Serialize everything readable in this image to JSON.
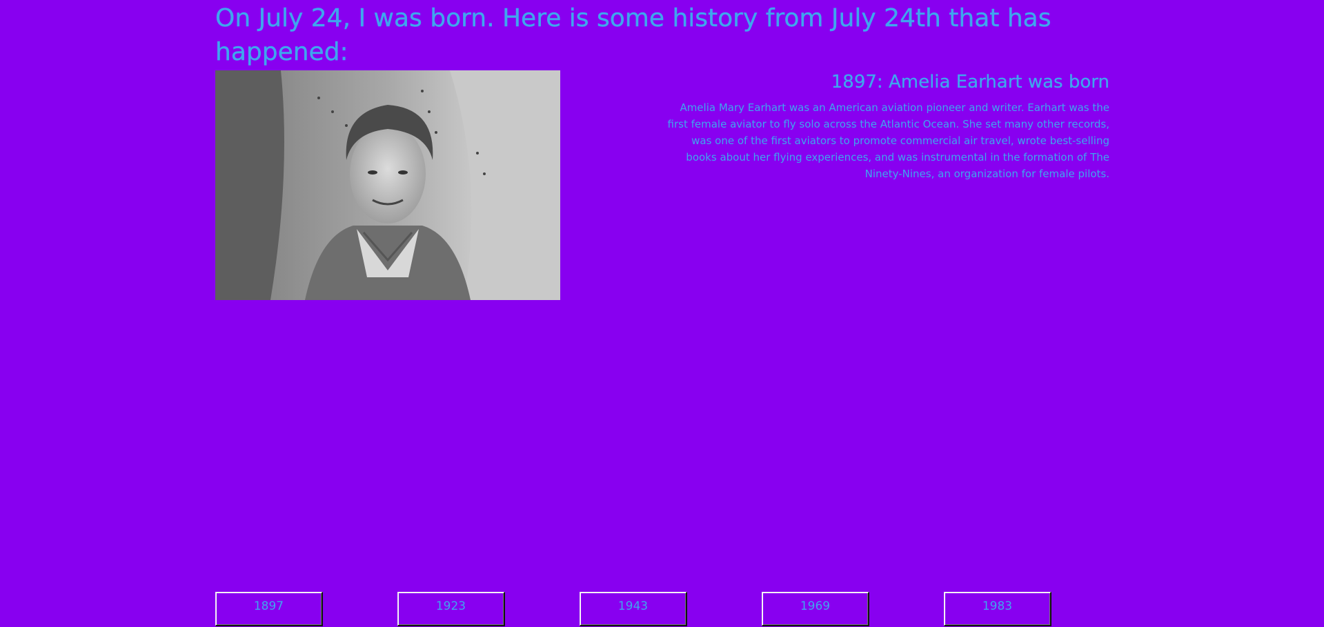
{
  "page": {
    "heading": "On July 24, I was born. Here is some history from July 24th that has happened:"
  },
  "event": {
    "title": "1897: Amelia Earhart was born",
    "description": "Amelia Mary Earhart was an American aviation pioneer and writer. Earhart was the first female aviator to fly solo across the Atlantic Ocean. She set many other records, was one of the first aviators to promote commercial air travel, wrote best-selling books about her flying experiences, and was instrumental in the formation of The Ninety-Nines, an organization for female pilots."
  },
  "year_buttons": [
    "1897",
    "1923",
    "1943",
    "1969",
    "1983"
  ],
  "colors": {
    "background": "#8800f0",
    "text_accent": "#3fa6ee"
  }
}
